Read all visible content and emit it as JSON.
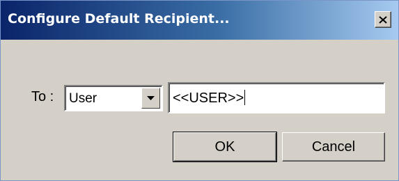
{
  "dialog": {
    "title": "Configure Default Recipient...",
    "close_icon": "close-icon"
  },
  "form": {
    "to_label": "To :",
    "recipient_type": "User",
    "recipient_value": "<<USER>>"
  },
  "buttons": {
    "ok_label": "OK",
    "cancel_label": "Cancel"
  },
  "colors": {
    "title_gradient_start": "#0a246a",
    "title_gradient_end": "#a6caf0",
    "dialog_background": "#d4d0c8"
  }
}
